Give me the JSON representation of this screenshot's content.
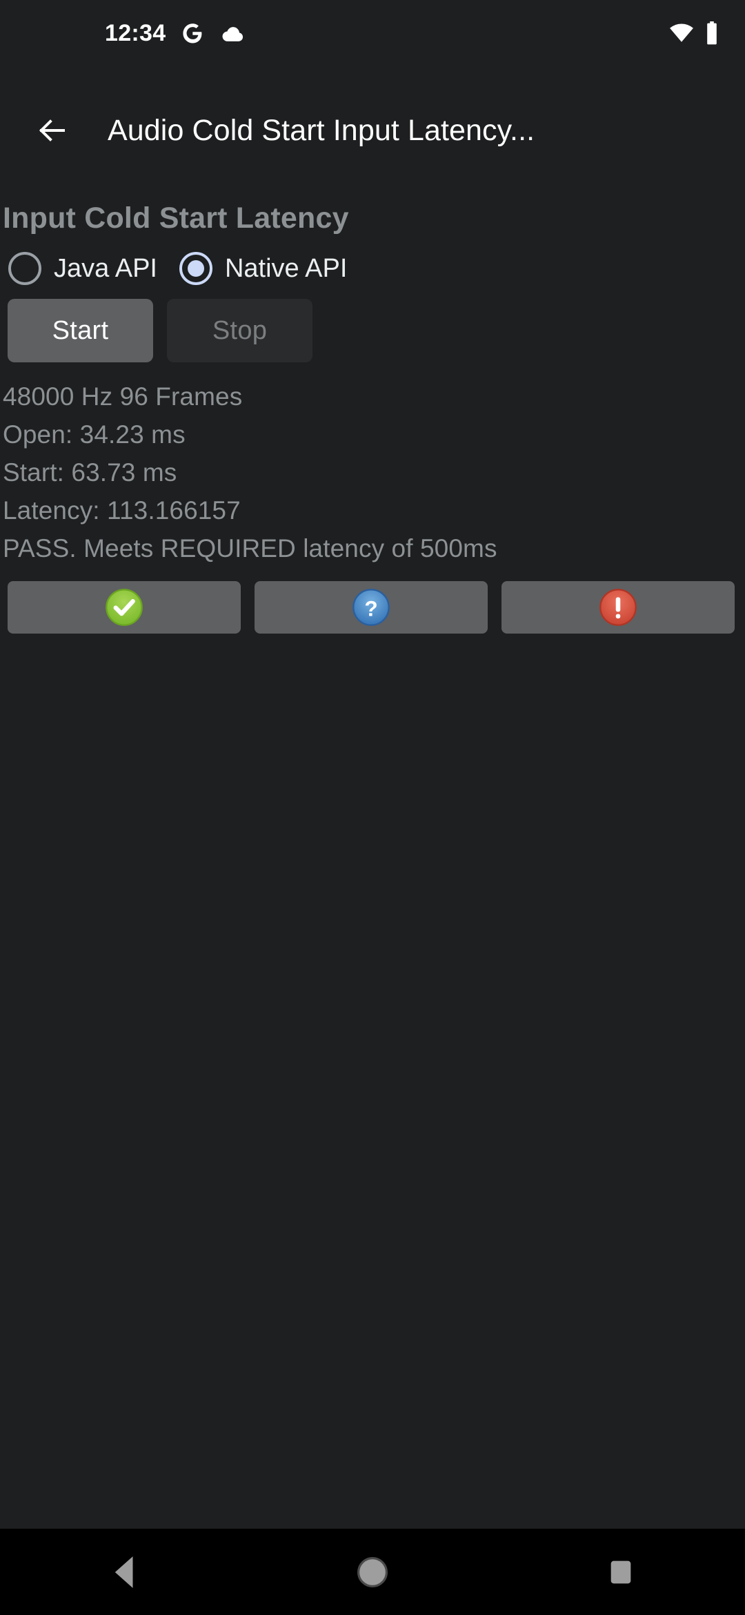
{
  "status_bar": {
    "clock": "12:34",
    "icons": [
      "google-g-icon",
      "cloud-icon"
    ],
    "right_icons": [
      "wifi-icon",
      "battery-icon"
    ]
  },
  "app_bar": {
    "back_icon": "arrow-back-icon",
    "title": "Audio Cold Start Input Latency..."
  },
  "main": {
    "heading": "Input Cold Start Latency",
    "radio_group": {
      "options": [
        {
          "label": "Java API",
          "selected": false
        },
        {
          "label": "Native API",
          "selected": true
        }
      ]
    },
    "buttons": {
      "start_label": "Start",
      "stop_label": "Stop"
    },
    "results": [
      "48000 Hz 96 Frames",
      "Open: 34.23 ms",
      "Start: 63.73 ms",
      "Latency: 113.166157",
      "PASS. Meets REQUIRED latency of 500ms"
    ],
    "verdict_buttons": [
      {
        "icon": "pass-check-icon",
        "color": "#8cc63e"
      },
      {
        "icon": "unknown-question-icon",
        "color": "#4a8fd0"
      },
      {
        "icon": "fail-exclamation-icon",
        "color": "#d9503f"
      }
    ]
  },
  "nav_bar": {
    "back": "nav-back-icon",
    "home": "nav-home-icon",
    "recents": "nav-recents-icon"
  },
  "colors": {
    "background": "#1d1f20",
    "nav_background": "#000000",
    "heading_text": "#8d9194",
    "body_text": "#8d9194",
    "accent_radio": "#ccd9f7",
    "button_enabled": "#5f6062",
    "button_disabled": "#2a2b2c"
  }
}
